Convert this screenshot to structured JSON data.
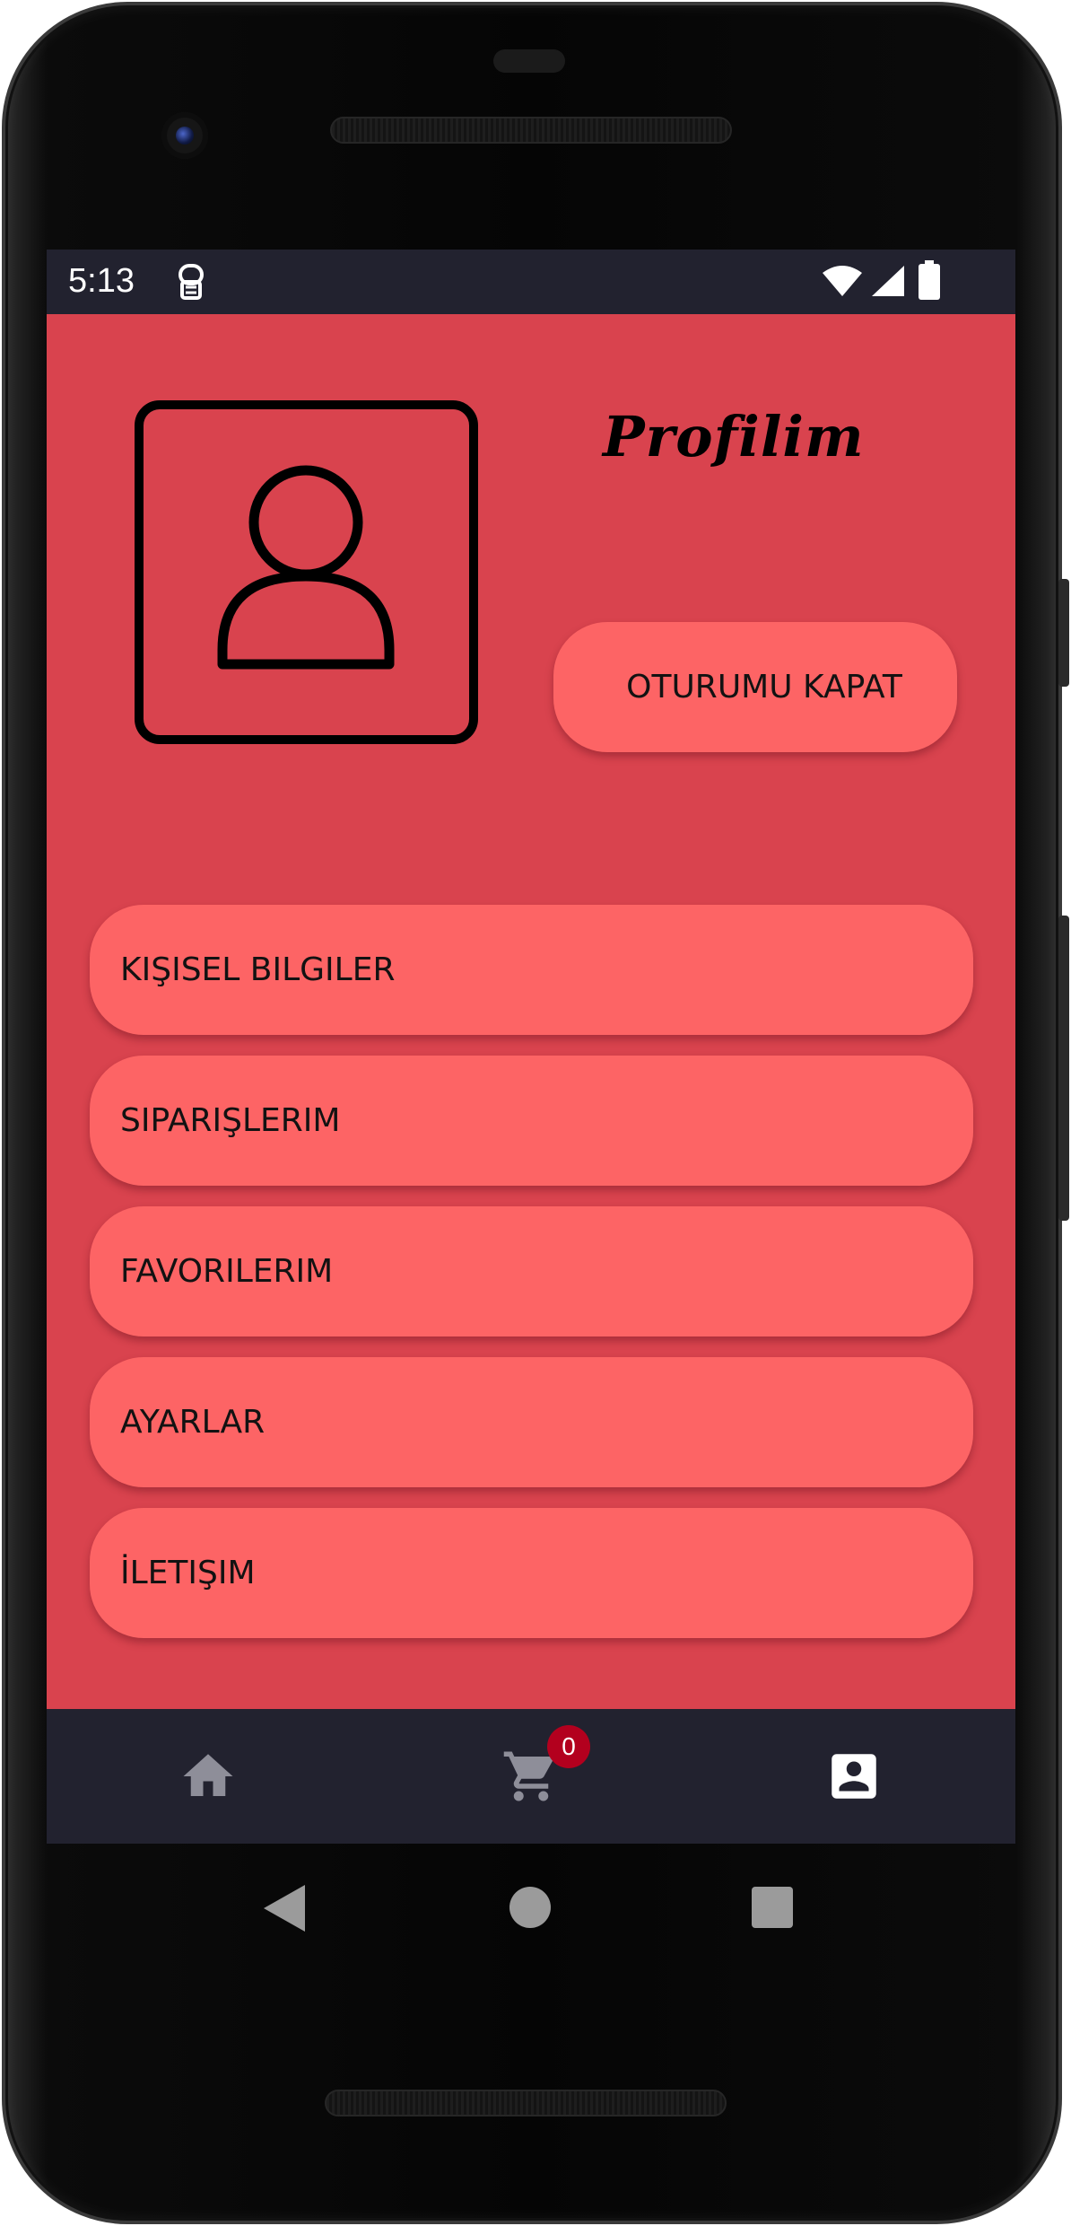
{
  "status_bar": {
    "time": "5:13",
    "icons": [
      "notification-icon",
      "wifi-icon",
      "signal-icon",
      "battery-icon"
    ]
  },
  "profile": {
    "title": "Profilim",
    "avatar_icon": "person-icon",
    "logout_label": "OTURUMU KAPAT"
  },
  "menu": {
    "items": [
      {
        "label": "KIŞISEL BILGILER"
      },
      {
        "label": "SIPARIŞLERIM"
      },
      {
        "label": "FAVORILERIM"
      },
      {
        "label": "AYARLAR"
      },
      {
        "label": "İLETIŞIM"
      }
    ]
  },
  "bottom_nav": {
    "items": [
      {
        "icon": "home-icon",
        "active": false
      },
      {
        "icon": "cart-icon",
        "active": false
      },
      {
        "icon": "account-box-icon",
        "active": true
      }
    ],
    "cart_badge": "0"
  },
  "colors": {
    "background": "#d9434e",
    "button": "#fd6465",
    "bar": "#22222f",
    "badge": "#b3001e",
    "nav_inactive": "#8e8e99",
    "nav_active": "#ffffff"
  }
}
